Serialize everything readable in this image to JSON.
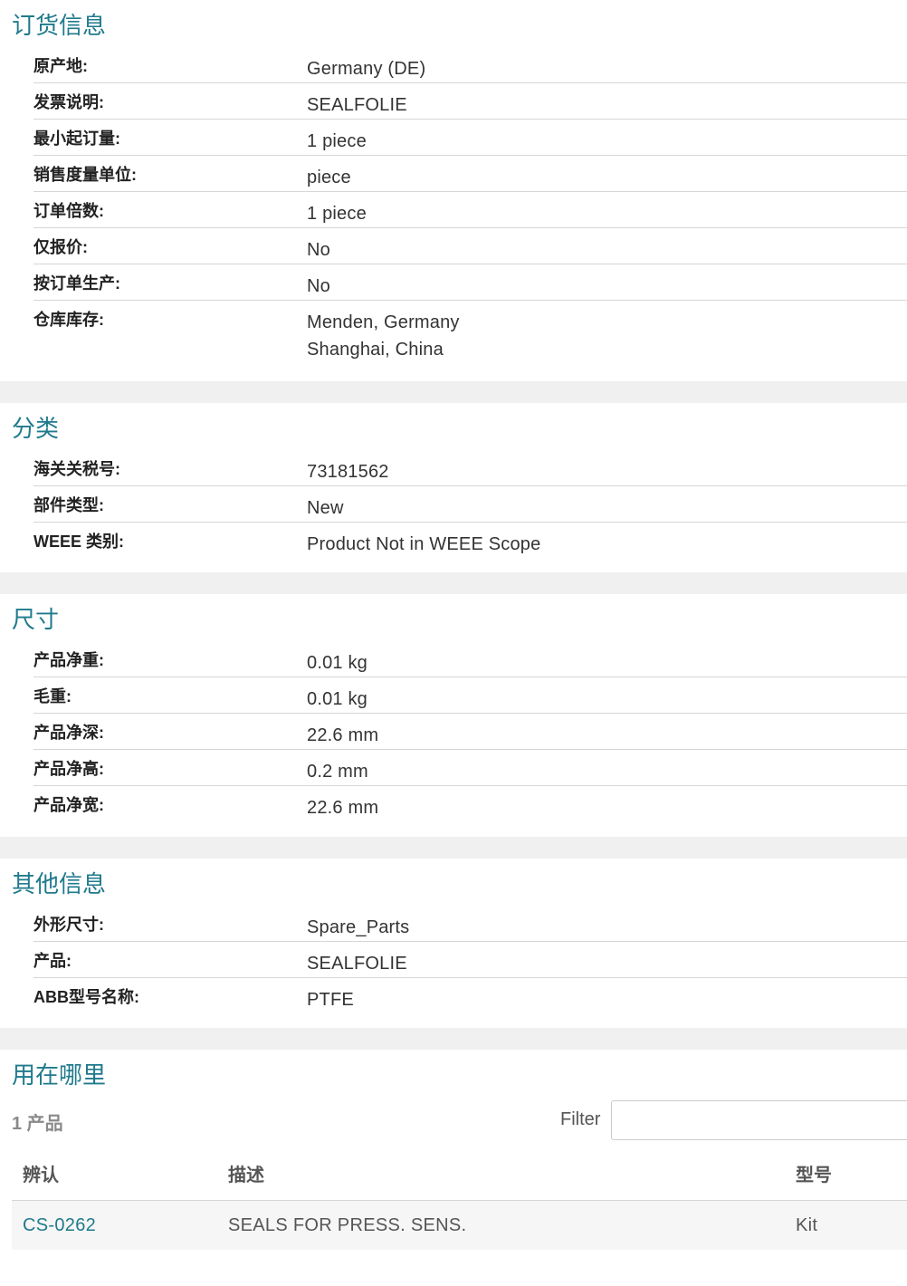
{
  "sections": [
    {
      "title": "订货信息",
      "rows": [
        {
          "label": "原产地:",
          "value": "Germany (DE)"
        },
        {
          "label": "发票说明:",
          "value": "SEALFOLIE"
        },
        {
          "label": "最小起订量:",
          "value": "1 piece"
        },
        {
          "label": "销售度量单位:",
          "value": "piece"
        },
        {
          "label": "订单倍数:",
          "value": "1 piece"
        },
        {
          "label": "仅报价:",
          "value": "No"
        },
        {
          "label": "按订单生产:",
          "value": "No"
        },
        {
          "label": "仓库库存:",
          "value": "Menden, Germany",
          "value2": "Shanghai, China"
        }
      ]
    },
    {
      "title": "分类",
      "rows": [
        {
          "label": "海关关税号:",
          "value": "73181562"
        },
        {
          "label": "部件类型:",
          "value": "New"
        },
        {
          "label": "WEEE 类别:",
          "value": "Product Not in WEEE Scope"
        }
      ]
    },
    {
      "title": "尺寸",
      "rows": [
        {
          "label": "产品净重:",
          "value": "0.01 kg"
        },
        {
          "label": "毛重:",
          "value": "0.01 kg"
        },
        {
          "label": "产品净深:",
          "value": "22.6 mm"
        },
        {
          "label": "产品净高:",
          "value": "0.2 mm"
        },
        {
          "label": "产品净宽:",
          "value": "22.6 mm"
        }
      ]
    },
    {
      "title": "其他信息",
      "rows": [
        {
          "label": "外形尺寸:",
          "value": "Spare_Parts"
        },
        {
          "label": "产品:",
          "value": "SEALFOLIE"
        },
        {
          "label": "ABB型号名称:",
          "value": "PTFE"
        }
      ]
    }
  ],
  "where_used": {
    "title": "用在哪里",
    "count": "1 产品",
    "filter_label": "Filter",
    "filter_value": "",
    "columns": [
      "辨认",
      "描述",
      "型号"
    ],
    "rows": [
      {
        "id": "CS-0262",
        "description": "SEALS FOR PRESS. SENS.",
        "model": "Kit"
      }
    ]
  },
  "colors": {
    "accent": "#1f7a8c",
    "separator": "#f0f0f0"
  }
}
